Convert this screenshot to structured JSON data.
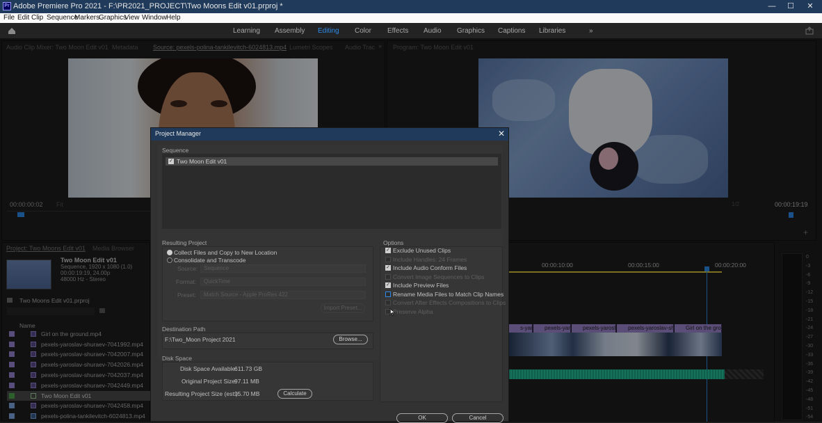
{
  "titlebar": {
    "title": "Adobe Premiere Pro 2021 - F:\\PR2021_PROJECT\\Two Moons Edit v01.prproj *",
    "logo_text": "Pr",
    "minimize": "—",
    "maximize": "☐",
    "close": "✕"
  },
  "menu": [
    "File",
    "Edit",
    "Clip",
    "Sequence",
    "Markers",
    "Graphics",
    "View",
    "Window",
    "Help"
  ],
  "workspaces": [
    "Learning",
    "Assembly",
    "Editing",
    "Color",
    "Effects",
    "Audio",
    "Graphics",
    "Captions",
    "Libraries"
  ],
  "workspace_more": "»",
  "source_panel": {
    "tabs": [
      "Audio Clip Mixer: Two Moon Edit v01",
      "Metadata",
      "Source: pexels-polina-tankilevitch-6024813.mp4",
      "Lumetri Scopes",
      "Audio Trac"
    ],
    "more": "»",
    "timecode": "00:00:00:02",
    "fit": "Fit"
  },
  "program_panel": {
    "title": "Program: Two Moon Edit v01",
    "timecode": "00:00:19:19",
    "zoom": "1/2"
  },
  "project_panel": {
    "tabs": [
      "Project: Two Moons Edit v01",
      "Media Browser"
    ],
    "seq_name": "Two Moon Edit v01",
    "seq_info1": "Sequence, 1920 x 1080 (1.0)",
    "seq_info2": "00:00:19:19, 24.00p",
    "seq_info3": "48000 Hz - Stereo",
    "project_file": "Two Moons Edit v01.prproj",
    "col_name": "Name",
    "items": [
      "Girl on the ground.mp4",
      "pexels-yaroslav-shuraev-7041992.mp4",
      "pexels-yaroslav-shuraev-7042007.mp4",
      "pexels-yaroslav-shuraev-7042026.mp4",
      "pexels-yaroslav-shuraev-7042037.mp4",
      "pexels-yaroslav-shuraev-7042449.mp4",
      "Two Moon Edit v01",
      "pexels-yaroslav-shuraev-7042458.mp4",
      "pexels-polina-tankilevitch-6024813.mp4"
    ]
  },
  "timeline": {
    "times": [
      "00:00:10:00",
      "00:00:15:00",
      "00:00:20:00"
    ],
    "clips": [
      "s-yarosla",
      "pexels-yar",
      "pexels-yarosl",
      "pexels-yaroslav-sh",
      "Girl on the grou"
    ]
  },
  "meter_ticks": [
    "0",
    "-3",
    "-6",
    "-9",
    "-12",
    "-15",
    "-18",
    "-21",
    "-24",
    "-27",
    "-30",
    "-33",
    "-36",
    "-39",
    "-42",
    "-45",
    "-48",
    "-51",
    "-54"
  ],
  "dialog": {
    "title": "Project Manager",
    "close": "✕",
    "sequence_label": "Sequence",
    "sequence_item": "Two Moon Edit v01",
    "resulting_project_label": "Resulting Project",
    "radio_collect": "Collect Files and Copy to New Location",
    "radio_consolidate": "Consolidate and Transcode",
    "source_label": "Source:",
    "source_value": "Sequence",
    "format_label": "Format:",
    "format_value": "QuickTime",
    "preset_label": "Preset:",
    "preset_value": "Match Source - Apple ProRes 422",
    "import_preset": "Import Preset...",
    "options_label": "Options",
    "options": [
      {
        "label": "Exclude Unused Clips",
        "checked": true,
        "disabled": false
      },
      {
        "label": "Include Handles:  24  Frames",
        "checked": false,
        "disabled": true
      },
      {
        "label": "Include Audio Conform Files",
        "checked": true,
        "disabled": false
      },
      {
        "label": "Convert Image Sequences to Clips",
        "checked": false,
        "disabled": true
      },
      {
        "label": "Include Preview Files",
        "checked": true,
        "disabled": false
      },
      {
        "label": "Rename Media Files to Match Clip Names",
        "checked": false,
        "disabled": false
      },
      {
        "label": "Convert After Effects Compositions to Clips",
        "checked": false,
        "disabled": true
      },
      {
        "label": "Preserve Alpha",
        "checked": false,
        "disabled": true
      }
    ],
    "dest_label": "Destination Path",
    "dest_value": "F:\\Two_Moon Project 2021",
    "browse": "Browse...",
    "disk_label": "Disk Space",
    "disk_available_label": "Disk Space Available:",
    "disk_available": "611.73 GB",
    "orig_size_label": "Original Project Size:",
    "orig_size": "97.11 MB",
    "result_size_label": "Resulting Project Size (est.):",
    "result_size": "95.70 MB",
    "calculate": "Calculate",
    "ok": "OK",
    "cancel": "Cancel"
  }
}
